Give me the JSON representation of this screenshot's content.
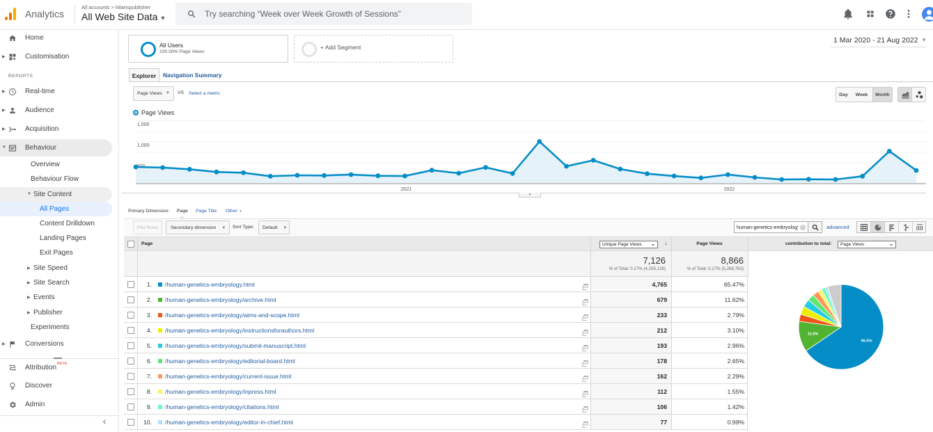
{
  "header": {
    "app_name": "Analytics",
    "breadcrumb": "All accounts > hilarispublisher",
    "property": "All Web Site Data",
    "search_placeholder": "Try searching “Week over Week Growth of Sessions”",
    "icons": [
      "search-icon",
      "notifications-icon",
      "apps-icon",
      "help-icon",
      "more-vert-icon",
      "account-avatar"
    ]
  },
  "sidebar": {
    "reports_heading": "REPORTS",
    "attribution_badge": "BETA",
    "collapse_glyph": "‹",
    "items": [
      {
        "label": "Home",
        "icon": "home-icon"
      },
      {
        "label": "Customisation",
        "icon": "dashboard-icon"
      },
      {
        "label": "Real-time",
        "icon": "clock-icon"
      },
      {
        "label": "Audience",
        "icon": "person-icon"
      },
      {
        "label": "Acquisition",
        "icon": "acquisition-icon"
      },
      {
        "label": "Behaviour",
        "icon": "behaviour-icon"
      },
      {
        "label": "Overview"
      },
      {
        "label": "Behaviour Flow"
      },
      {
        "label": "Site Content"
      },
      {
        "label": "All Pages",
        "selected": true
      },
      {
        "label": "Content Drilldown"
      },
      {
        "label": "Landing Pages"
      },
      {
        "label": "Exit Pages"
      },
      {
        "label": "Site Speed"
      },
      {
        "label": "Site Search"
      },
      {
        "label": "Events"
      },
      {
        "label": "Publisher"
      },
      {
        "label": "Experiments"
      },
      {
        "label": "Conversions",
        "icon": "flag-icon"
      },
      {
        "label": "Attribution",
        "icon": "attribution-icon"
      },
      {
        "label": "Discover",
        "icon": "lightbulb-icon"
      },
      {
        "label": "Admin",
        "icon": "gear-icon"
      }
    ]
  },
  "segments": {
    "active": {
      "name": "All Users",
      "sub": "100.00% Page Views"
    },
    "add_label": "+ Add Segment"
  },
  "date_range": "1 Mar 2020 - 21 Aug 2022",
  "report_tabs": [
    {
      "label": "Explorer",
      "active": true
    },
    {
      "label": "Navigation Summary",
      "active": false
    }
  ],
  "explorer": {
    "metric": "Page Views",
    "vs": "VS",
    "select_metric": "Select a metric",
    "legend": "Page Views",
    "granularity": [
      "Day",
      "Week",
      "Month"
    ],
    "active_granularity": "Month",
    "chart_types": [
      "line-chart-icon",
      "motion-chart-icon"
    ],
    "accent_color": "#058dc7"
  },
  "dimensions": {
    "label": "Primary Dimension:",
    "options": [
      "Page",
      "Page Title",
      "Other"
    ],
    "active": "Page"
  },
  "toolbar": {
    "plot_rows": "Plot Rows",
    "secondary_dimension": "Secondary dimension",
    "sort_type_label": "Sort Type:",
    "sort_type": "Default",
    "filter_value": "human-genetics-embryology",
    "advanced": "advanced",
    "view_modes": [
      "data-view-icon",
      "percentage-view-icon",
      "performance-view-icon",
      "comparison-view-icon",
      "pivot-view-icon"
    ],
    "active_view": "percentage-view-icon"
  },
  "table": {
    "columns": {
      "page": "Page",
      "unique_page_views": "Unique Page Views",
      "page_views": "Page Views",
      "contribution_label": "contribution to total:",
      "contribution_metric": "Page Views"
    },
    "totals": {
      "unique_page_views": "7,126",
      "unique_sub": "% of Total: 0.17% (4,205,139)",
      "page_views": "8,866",
      "page_views_sub": "% of Total: 0.17% (5,268,763)"
    },
    "rows": [
      {
        "index": "1.",
        "page": "/human-genetics-embryology.html",
        "unique_page_views": "4,765",
        "page_views_percent": "65.47%",
        "color": "#058DC7"
      },
      {
        "index": "2.",
        "page": "/human-genetics-embryology/archive.html",
        "unique_page_views": "679",
        "page_views_percent": "11.62%",
        "color": "#50B432"
      },
      {
        "index": "3.",
        "page": "/human-genetics-embryology/aims-and-scope.html",
        "unique_page_views": "233",
        "page_views_percent": "2.79%",
        "color": "#ED561B"
      },
      {
        "index": "4.",
        "page": "/human-genetics-embryology/instructionsforauthors.html",
        "unique_page_views": "212",
        "page_views_percent": "3.10%",
        "color": "#EDEF00"
      },
      {
        "index": "5.",
        "page": "/human-genetics-embryology/submit-manuscript.html",
        "unique_page_views": "193",
        "page_views_percent": "2.96%",
        "color": "#24CBE5"
      },
      {
        "index": "6.",
        "page": "/human-genetics-embryology/editorial-board.html",
        "unique_page_views": "178",
        "page_views_percent": "2.65%",
        "color": "#64E572"
      },
      {
        "index": "7.",
        "page": "/human-genetics-embryology/current-issue.html",
        "unique_page_views": "162",
        "page_views_percent": "2.29%",
        "color": "#FF9655"
      },
      {
        "index": "8.",
        "page": "/human-genetics-embryology/inpress.html",
        "unique_page_views": "112",
        "page_views_percent": "1.55%",
        "color": "#FFF263"
      },
      {
        "index": "9.",
        "page": "/human-genetics-embryology/citations.html",
        "unique_page_views": "106",
        "page_views_percent": "1.42%",
        "color": "#6AF9C4"
      },
      {
        "index": "10.",
        "page": "/human-genetics-embryology/editor-in-chief.html",
        "unique_page_views": "77",
        "page_views_percent": "0.99%",
        "color": "#B2DEFF"
      }
    ]
  },
  "chart_data": [
    {
      "type": "line",
      "title": "",
      "xlabel": "",
      "ylabel": "",
      "legend": [
        "Page Views"
      ],
      "legend_position": "top-left",
      "x": [
        "Mar 2020",
        "Apr 2020",
        "May 2020",
        "Jun 2020",
        "Jul 2020",
        "Aug 2020",
        "Sep 2020",
        "Oct 2020",
        "Nov 2020",
        "Dec 2020",
        "Jan 2021",
        "Feb 2021",
        "Mar 2021",
        "Apr 2021",
        "May 2021",
        "Jun 2021",
        "Jul 2021",
        "Aug 2021",
        "Sep 2021",
        "Oct 2021",
        "Nov 2021",
        "Dec 2021",
        "Jan 2022",
        "Feb 2022",
        "Mar 2022",
        "Apr 2022",
        "May 2022",
        "Jun 2022",
        "Jul 2022",
        "Aug 2022"
      ],
      "series": [
        {
          "name": "Page Views",
          "color": "#058dc7",
          "values": [
            400,
            385,
            345,
            280,
            262,
            178,
            200,
            195,
            217,
            189,
            183,
            322,
            250,
            389,
            245,
            1011,
            417,
            561,
            350,
            239,
            183,
            139,
            217,
            150,
            100,
            106,
            100,
            178,
            778,
            317
          ]
        }
      ],
      "x_tick_labels": [
        {
          "label": "2021",
          "at": "Jan 2021"
        },
        {
          "label": "2022",
          "at": "Jan 2022"
        }
      ],
      "y_ticks": [
        {
          "value": 500,
          "label": "500"
        },
        {
          "value": 1000,
          "label": "1,000"
        },
        {
          "value": 1500,
          "label": "1,500"
        }
      ],
      "ylim": [
        0,
        1500
      ],
      "grid": true,
      "grid_step": 250
    },
    {
      "type": "pie",
      "title": "contribution to total: Page Views",
      "categories": [
        "/human-genetics-embryology.html",
        "/human-genetics-embryology/archive.html",
        "/human-genetics-embryology/aims-and-scope.html",
        "/human-genetics-embryology/instructionsforauthors.html",
        "/human-genetics-embryology/submit-manuscript.html",
        "/human-genetics-embryology/editorial-board.html",
        "/human-genetics-embryology/current-issue.html",
        "/human-genetics-embryology/inpress.html",
        "/human-genetics-embryology/citations.html",
        "/human-genetics-embryology/editor-in-chief.html",
        "Other"
      ],
      "values": [
        65.47,
        11.62,
        2.79,
        3.1,
        2.96,
        2.65,
        2.29,
        1.55,
        1.42,
        0.99,
        5.16
      ],
      "colors": [
        "#058DC7",
        "#50B432",
        "#ED561B",
        "#EDEF00",
        "#24CBE5",
        "#64E572",
        "#FF9655",
        "#FFF263",
        "#6AF9C4",
        "#B2DEFF",
        "#CCCCCC"
      ],
      "slice_labels": [
        "65.5%",
        "11.6%",
        "",
        "",
        "",
        "",
        "",
        "",
        "",
        "",
        ""
      ]
    }
  ]
}
